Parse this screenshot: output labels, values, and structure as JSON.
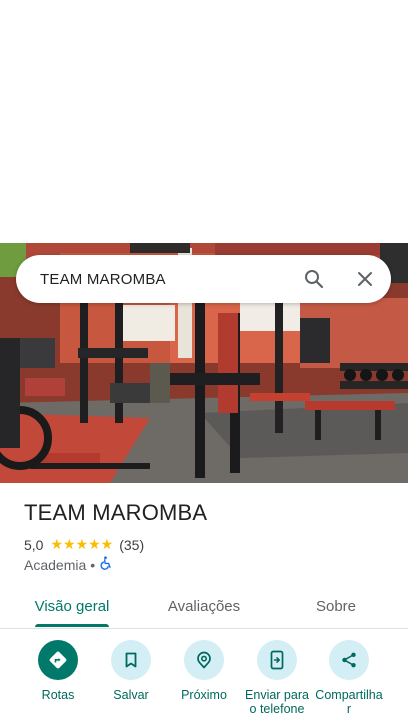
{
  "search": {
    "query": "TEAM MAROMBA"
  },
  "place": {
    "title": "TEAM MAROMBA",
    "rating": "5,0",
    "stars": "★★★★★",
    "review_count": "(35)",
    "category": "Academia",
    "separator": "•"
  },
  "tabs": [
    {
      "label": "Visão geral",
      "active": true
    },
    {
      "label": "Avaliações",
      "active": false
    },
    {
      "label": "Sobre",
      "active": false
    }
  ],
  "actions": [
    {
      "label": "Rotas",
      "icon": "directions-icon"
    },
    {
      "label": "Salvar",
      "icon": "bookmark-icon"
    },
    {
      "label": "Próximo",
      "icon": "nearby-icon"
    },
    {
      "label": "Enviar para o telefone",
      "icon": "send-to-phone-icon"
    },
    {
      "label": "Compartilhar",
      "icon": "share-icon"
    }
  ],
  "colors": {
    "accent": "#00796b",
    "star": "#fbbc04",
    "action_bg": "#d3eef5"
  }
}
